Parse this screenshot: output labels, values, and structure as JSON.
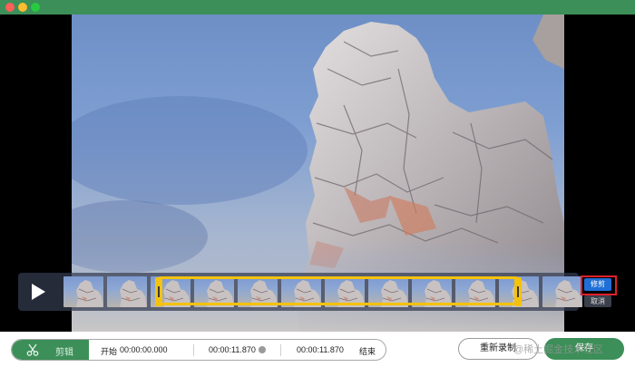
{
  "window": {
    "controls": [
      "close",
      "minimize",
      "zoom"
    ]
  },
  "player": {
    "play_icon": "play-icon"
  },
  "trim_panel": {
    "trim_label": "修剪",
    "cancel_label": "取消"
  },
  "editor": {
    "clip_label": "剪辑",
    "clip_icon": "scissors-icon",
    "start_label": "开始",
    "start_time": "00:00:00.000",
    "duration_time": "00:00:11.870",
    "end_time": "00:00:11.870",
    "end_label": "结束"
  },
  "actions": {
    "rerecord_label": "重新录制",
    "save_label": "保存"
  },
  "watermark": "@稀土掘金技术社区",
  "colors": {
    "accent_green": "#3c8f58",
    "selection_yellow": "#f4c20d",
    "trim_blue": "#1f6fd6",
    "highlight_red": "#e0202a"
  }
}
